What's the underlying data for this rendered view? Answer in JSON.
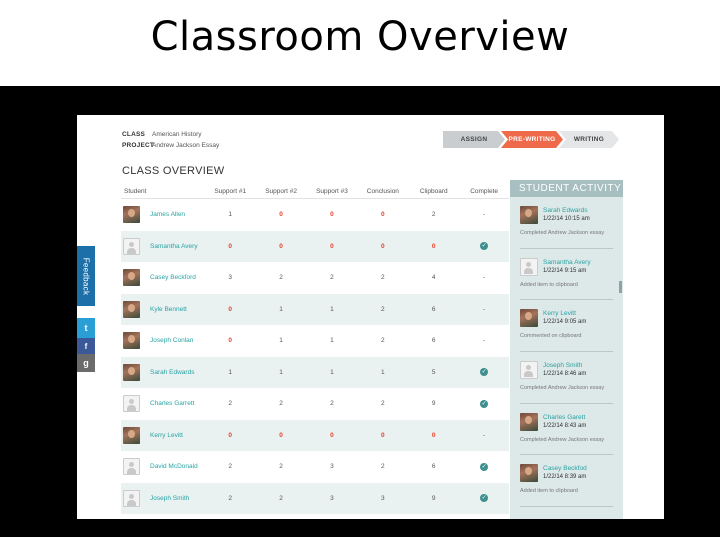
{
  "slide": {
    "title": "Classroom Overview"
  },
  "header": {
    "class_label": "CLASS",
    "class_value": "American History",
    "project_label": "PROJECT",
    "project_value": "Andrew Jackson Essay"
  },
  "steps": [
    {
      "label": "ASSIGN",
      "state": "done"
    },
    {
      "label": "PRE-WRITING",
      "state": "active"
    },
    {
      "label": "WRITING",
      "state": "upcoming"
    }
  ],
  "overview": {
    "title": "CLASS OVERVIEW",
    "columns": [
      "Student",
      "Support #1",
      "Support #2",
      "Support #3",
      "Conclusion",
      "Clipboard",
      "Complete"
    ],
    "rows": [
      {
        "name": "James Allen",
        "avatar": "photo",
        "s1": "1",
        "s2": "0",
        "s3": "0",
        "conclusion": "0",
        "clipboard": "2",
        "complete": "-"
      },
      {
        "name": "Samantha Avery",
        "avatar": "blank",
        "s1": "0",
        "s2": "0",
        "s3": "0",
        "conclusion": "0",
        "clipboard": "0",
        "complete": "check"
      },
      {
        "name": "Casey Beckford",
        "avatar": "photo",
        "s1": "3",
        "s2": "2",
        "s3": "2",
        "conclusion": "2",
        "clipboard": "4",
        "complete": "-"
      },
      {
        "name": "Kyle Bennett",
        "avatar": "photo",
        "s1": "0",
        "s2": "1",
        "s3": "1",
        "conclusion": "2",
        "clipboard": "6",
        "complete": "-"
      },
      {
        "name": "Joseph Conlan",
        "avatar": "photo",
        "s1": "0",
        "s2": "1",
        "s3": "1",
        "conclusion": "2",
        "clipboard": "6",
        "complete": "-"
      },
      {
        "name": "Sarah Edwards",
        "avatar": "photo",
        "s1": "1",
        "s2": "1",
        "s3": "1",
        "conclusion": "1",
        "clipboard": "5",
        "complete": "check"
      },
      {
        "name": "Charles Garrett",
        "avatar": "blank",
        "s1": "2",
        "s2": "2",
        "s3": "2",
        "conclusion": "2",
        "clipboard": "9",
        "complete": "check"
      },
      {
        "name": "Kerry Levitt",
        "avatar": "photo",
        "s1": "0",
        "s2": "0",
        "s3": "0",
        "conclusion": "0",
        "clipboard": "0",
        "complete": "-"
      },
      {
        "name": "David McDonald",
        "avatar": "blank",
        "s1": "2",
        "s2": "2",
        "s3": "3",
        "conclusion": "2",
        "clipboard": "6",
        "complete": "check"
      },
      {
        "name": "Joseph Smith",
        "avatar": "blank",
        "s1": "2",
        "s2": "2",
        "s3": "3",
        "conclusion": "3",
        "clipboard": "9",
        "complete": "check"
      }
    ]
  },
  "activity": {
    "title": "STUDENT ACTIVITY",
    "items": [
      {
        "name": "Sarah Edwards",
        "time": "1/22/14  10:15 am",
        "message": "Completed Andrew Jackson essay",
        "avatar": "photo"
      },
      {
        "name": "Samantha Avery",
        "time": "1/22/14  9:15 am",
        "message": "Added item to clipboard",
        "avatar": "blank"
      },
      {
        "name": "Kerry Levitt",
        "time": "1/22/14  9:05 am",
        "message": "Commented on clipboard",
        "avatar": "photo"
      },
      {
        "name": "Joseph Smith",
        "time": "1/22/14  8:46 am",
        "message": "Completed Andrew Jackson essay",
        "avatar": "blank"
      },
      {
        "name": "Charles Garett",
        "time": "1/22/14  8:43 am",
        "message": "Completed Andrew Jackson essay",
        "avatar": "photo"
      },
      {
        "name": "Casey Beckfod",
        "time": "1/22/14  8:39 am",
        "message": "Added item to clipboard",
        "avatar": "photo"
      }
    ]
  },
  "sidebar": {
    "feedback_label": "Feedback",
    "social": [
      {
        "icon": "twitter-icon",
        "glyph": "t"
      },
      {
        "icon": "facebook-icon",
        "glyph": "f"
      },
      {
        "icon": "google-plus-icon",
        "glyph": "g"
      }
    ]
  },
  "colors": {
    "accent": "#ee6a4a",
    "teal": "#2aa3a3",
    "zero": "#e8412b",
    "complete": "#3e8f8e",
    "activity_header": "#a7bfc0"
  }
}
